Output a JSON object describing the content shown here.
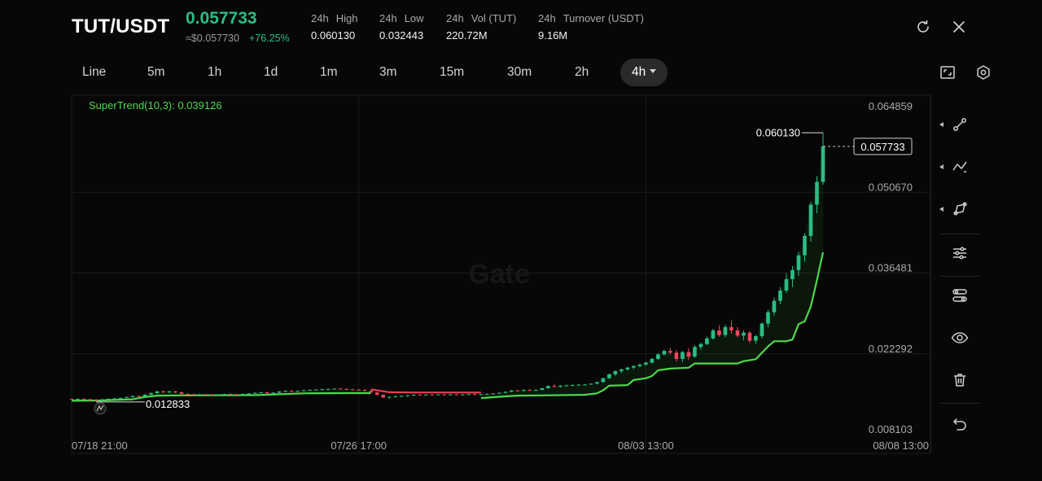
{
  "header": {
    "pair": "TUT/USDT",
    "price": "0.057733",
    "price_usd": "≈$0.057730",
    "change": "+76.25%",
    "stats": [
      {
        "label_a": "24h",
        "label_b": "High",
        "value": "0.060130"
      },
      {
        "label_a": "24h",
        "label_b": "Low",
        "value": "0.032443"
      },
      {
        "label_a": "24h",
        "label_b": "Vol (TUT)",
        "value": "220.72M"
      },
      {
        "label_a": "24h",
        "label_b": "Turnover (USDT)",
        "value": "9.16M"
      }
    ],
    "icons": [
      "refresh-icon",
      "close-icon"
    ]
  },
  "timeframes": {
    "items": [
      "Line",
      "5m",
      "1h",
      "1d",
      "1m",
      "3m",
      "15m",
      "30m",
      "2h",
      "4h"
    ],
    "active": "4h"
  },
  "toolbar_icons": [
    "fullscreen-icon",
    "settings-icon"
  ],
  "sidebar_tools": [
    "line-tool-icon",
    "path-tool-icon",
    "shape-tool-icon",
    "sliders-icon",
    "indicator-icon",
    "visibility-icon",
    "delete-icon",
    "undo-icon"
  ],
  "chart_data": {
    "type": "candlestick",
    "indicator_label": "SuperTrend(10,3): 0.039126",
    "indicator_value": 0.039126,
    "watermark": "Gate",
    "y_ticks": [
      "0.064859",
      "0.050670",
      "0.036481",
      "0.022292",
      "0.008103"
    ],
    "y_tick_values": [
      0.064859,
      0.05067,
      0.036481,
      0.022292,
      0.008103
    ],
    "ylim": [
      0.008103,
      0.064859
    ],
    "x_ticks": [
      "07/18 21:00",
      "07/26 17:00",
      "08/03 13:00",
      "08/08 13:00"
    ],
    "x_tick_values": [
      0,
      47,
      94,
      124
    ],
    "xlim": [
      0,
      124
    ],
    "current_price_label": "0.057733",
    "current_price": 0.057733,
    "high_label": "0.060130",
    "high_value": 0.06013,
    "low_label": "0.012833",
    "low_value": 0.012833,
    "colors": {
      "up": "#2bbd85",
      "down": "#f0455f",
      "trend_up": "#4cd94c",
      "trend_down": "#e8414f"
    },
    "candles": [
      [
        0,
        0.0134,
        0.01345,
        0.0133,
        0.01335
      ],
      [
        1,
        0.01335,
        0.01343,
        0.01326,
        0.01338
      ],
      [
        2,
        0.01338,
        0.01346,
        0.0133,
        0.01332
      ],
      [
        3,
        0.01332,
        0.0134,
        0.013,
        0.01318
      ],
      [
        4,
        0.01318,
        0.01335,
        0.0129,
        0.0131
      ],
      [
        5,
        0.0131,
        0.01338,
        0.013,
        0.0133
      ],
      [
        6,
        0.0133,
        0.01345,
        0.01325,
        0.0134
      ],
      [
        7,
        0.0134,
        0.01352,
        0.01335,
        0.01345
      ],
      [
        8,
        0.01345,
        0.0136,
        0.01338,
        0.01355
      ],
      [
        9,
        0.01355,
        0.01375,
        0.0135,
        0.0137
      ],
      [
        10,
        0.0137,
        0.01395,
        0.01362,
        0.01388
      ],
      [
        11,
        0.01388,
        0.014,
        0.01375,
        0.0138
      ],
      [
        12,
        0.0138,
        0.0142,
        0.01375,
        0.01412
      ],
      [
        13,
        0.01412,
        0.0145,
        0.01405,
        0.0144
      ],
      [
        14,
        0.0144,
        0.0148,
        0.0143,
        0.0147
      ],
      [
        15,
        0.0147,
        0.01485,
        0.01445,
        0.01455
      ],
      [
        16,
        0.01455,
        0.0148,
        0.0144,
        0.0147
      ],
      [
        17,
        0.0147,
        0.01478,
        0.0144,
        0.01452
      ],
      [
        18,
        0.01452,
        0.01465,
        0.01415,
        0.01425
      ],
      [
        19,
        0.01425,
        0.01438,
        0.01405,
        0.0142
      ],
      [
        20,
        0.0142,
        0.01432,
        0.014,
        0.0141
      ],
      [
        21,
        0.0141,
        0.01428,
        0.01402,
        0.01418
      ],
      [
        22,
        0.01418,
        0.01428,
        0.01405,
        0.01412
      ],
      [
        23,
        0.01412,
        0.01424,
        0.014,
        0.01408
      ],
      [
        24,
        0.01408,
        0.0142,
        0.01398,
        0.01415
      ],
      [
        25,
        0.01415,
        0.0143,
        0.01405,
        0.01422
      ],
      [
        26,
        0.01422,
        0.01432,
        0.0141,
        0.01418
      ],
      [
        27,
        0.01418,
        0.01428,
        0.01405,
        0.01412
      ],
      [
        28,
        0.01412,
        0.0143,
        0.014,
        0.01425
      ],
      [
        29,
        0.01425,
        0.0144,
        0.01415,
        0.01432
      ],
      [
        30,
        0.01432,
        0.01452,
        0.01425,
        0.01445
      ],
      [
        31,
        0.01445,
        0.01462,
        0.01438,
        0.01455
      ],
      [
        32,
        0.01455,
        0.01462,
        0.0143,
        0.0144
      ],
      [
        33,
        0.0144,
        0.01455,
        0.01432,
        0.01448
      ],
      [
        34,
        0.01448,
        0.01475,
        0.0144,
        0.01468
      ],
      [
        35,
        0.01468,
        0.0149,
        0.01458,
        0.0148
      ],
      [
        36,
        0.0148,
        0.01492,
        0.0146,
        0.0147
      ],
      [
        37,
        0.0147,
        0.01485,
        0.01462,
        0.01478
      ],
      [
        38,
        0.01478,
        0.01498,
        0.0147,
        0.0149
      ],
      [
        39,
        0.0149,
        0.01505,
        0.01482,
        0.01496
      ],
      [
        40,
        0.01496,
        0.0151,
        0.0149,
        0.01502
      ],
      [
        41,
        0.01502,
        0.01515,
        0.01492,
        0.01508
      ],
      [
        42,
        0.01508,
        0.0152,
        0.01498,
        0.01512
      ],
      [
        43,
        0.01512,
        0.01525,
        0.01504,
        0.01518
      ],
      [
        44,
        0.01518,
        0.01528,
        0.01505,
        0.01512
      ],
      [
        45,
        0.01512,
        0.01522,
        0.01498,
        0.01506
      ],
      [
        46,
        0.01506,
        0.01515,
        0.0149,
        0.015
      ],
      [
        47,
        0.015,
        0.01512,
        0.01488,
        0.01495
      ],
      [
        48,
        0.01495,
        0.01505,
        0.0147,
        0.0148
      ],
      [
        49,
        0.0148,
        0.0149,
        0.0144,
        0.0145
      ],
      [
        50,
        0.0145,
        0.01462,
        0.014,
        0.0141
      ],
      [
        51,
        0.0141,
        0.01422,
        0.0135,
        0.01362
      ],
      [
        52,
        0.01362,
        0.0138,
        0.01338,
        0.01375
      ],
      [
        53,
        0.01375,
        0.01392,
        0.0136,
        0.01385
      ],
      [
        54,
        0.01385,
        0.01398,
        0.0137,
        0.0139
      ],
      [
        55,
        0.0139,
        0.01408,
        0.01375,
        0.014
      ],
      [
        56,
        0.014,
        0.01418,
        0.01388,
        0.0141
      ],
      [
        57,
        0.0141,
        0.0142,
        0.01395,
        0.01405
      ],
      [
        58,
        0.01405,
        0.01418,
        0.01396,
        0.01412
      ],
      [
        59,
        0.01412,
        0.01422,
        0.014,
        0.01408
      ],
      [
        60,
        0.01408,
        0.0142,
        0.01398,
        0.01415
      ],
      [
        61,
        0.01415,
        0.01426,
        0.01402,
        0.0141
      ],
      [
        62,
        0.0141,
        0.01422,
        0.014,
        0.01416
      ],
      [
        63,
        0.01416,
        0.01426,
        0.01404,
        0.0141
      ],
      [
        64,
        0.0141,
        0.01422,
        0.01398,
        0.01414
      ],
      [
        65,
        0.01414,
        0.01428,
        0.01406,
        0.0142
      ],
      [
        66,
        0.0142,
        0.01432,
        0.01408,
        0.01412
      ],
      [
        67,
        0.01412,
        0.01425,
        0.01402,
        0.01418
      ],
      [
        68,
        0.01418,
        0.0143,
        0.0141,
        0.01425
      ],
      [
        69,
        0.01425,
        0.0144,
        0.0142,
        0.01435
      ],
      [
        70,
        0.01435,
        0.01452,
        0.01428,
        0.01445
      ],
      [
        71,
        0.01445,
        0.0147,
        0.01438,
        0.01462
      ],
      [
        72,
        0.01462,
        0.01492,
        0.01455,
        0.01485
      ],
      [
        73,
        0.01485,
        0.01498,
        0.0147,
        0.01478
      ],
      [
        74,
        0.01478,
        0.015,
        0.0147,
        0.01495
      ],
      [
        75,
        0.01495,
        0.01508,
        0.0148,
        0.01488
      ],
      [
        76,
        0.01488,
        0.01502,
        0.01478,
        0.01495
      ],
      [
        77,
        0.01495,
        0.0153,
        0.0149,
        0.01525
      ],
      [
        78,
        0.01525,
        0.01575,
        0.01515,
        0.01565
      ],
      [
        79,
        0.01565,
        0.01605,
        0.0154,
        0.01555
      ],
      [
        80,
        0.01555,
        0.0158,
        0.01535,
        0.0157
      ],
      [
        81,
        0.0157,
        0.0159,
        0.01555,
        0.01575
      ],
      [
        82,
        0.01575,
        0.0159,
        0.01558,
        0.01582
      ],
      [
        83,
        0.01582,
        0.01598,
        0.0157,
        0.01588
      ],
      [
        84,
        0.01588,
        0.01602,
        0.01575,
        0.01592
      ],
      [
        85,
        0.01592,
        0.01612,
        0.01585,
        0.01605
      ],
      [
        86,
        0.01605,
        0.0164,
        0.01598,
        0.01632
      ],
      [
        87,
        0.01632,
        0.0171,
        0.01625,
        0.017
      ],
      [
        88,
        0.017,
        0.0178,
        0.0169,
        0.0177
      ],
      [
        89,
        0.0177,
        0.0184,
        0.0174,
        0.01825
      ],
      [
        90,
        0.01825,
        0.0187,
        0.0179,
        0.01855
      ],
      [
        91,
        0.01855,
        0.019,
        0.0183,
        0.01888
      ],
      [
        92,
        0.01888,
        0.0193,
        0.0186,
        0.01915
      ],
      [
        93,
        0.01915,
        0.0196,
        0.0189,
        0.0194
      ],
      [
        94,
        0.0194,
        0.0199,
        0.0192,
        0.01975
      ],
      [
        95,
        0.01975,
        0.0206,
        0.0196,
        0.0204
      ],
      [
        96,
        0.0204,
        0.0214,
        0.0202,
        0.0212
      ],
      [
        97,
        0.0212,
        0.022,
        0.021,
        0.0218
      ],
      [
        98,
        0.0218,
        0.0223,
        0.0212,
        0.0215
      ],
      [
        99,
        0.0215,
        0.022,
        0.0199,
        0.0204
      ],
      [
        100,
        0.0204,
        0.0218,
        0.0198,
        0.0216
      ],
      [
        101,
        0.0216,
        0.0223,
        0.0202,
        0.0208
      ],
      [
        102,
        0.0208,
        0.0228,
        0.0206,
        0.0225
      ],
      [
        103,
        0.0225,
        0.0233,
        0.022,
        0.023
      ],
      [
        104,
        0.023,
        0.0243,
        0.0228,
        0.024
      ],
      [
        105,
        0.024,
        0.0257,
        0.0238,
        0.0254
      ],
      [
        106,
        0.0254,
        0.0263,
        0.0243,
        0.0246
      ],
      [
        107,
        0.0246,
        0.0264,
        0.0242,
        0.026
      ],
      [
        108,
        0.026,
        0.0272,
        0.0248,
        0.0254
      ],
      [
        109,
        0.0254,
        0.026,
        0.0242,
        0.0245
      ],
      [
        110,
        0.0245,
        0.0254,
        0.0237,
        0.025
      ],
      [
        111,
        0.025,
        0.0253,
        0.0232,
        0.0236
      ],
      [
        112,
        0.0236,
        0.0246,
        0.023,
        0.0244
      ],
      [
        113,
        0.0244,
        0.0268,
        0.024,
        0.0266
      ],
      [
        114,
        0.0266,
        0.029,
        0.026,
        0.0286
      ],
      [
        115,
        0.0286,
        0.0312,
        0.028,
        0.0306
      ],
      [
        116,
        0.0306,
        0.033,
        0.03,
        0.0324
      ],
      [
        117,
        0.0324,
        0.0355,
        0.032,
        0.0344
      ],
      [
        118,
        0.0344,
        0.0367,
        0.033,
        0.036
      ],
      [
        119,
        0.036,
        0.0392,
        0.035,
        0.0386
      ],
      [
        120,
        0.0386,
        0.0425,
        0.0375,
        0.042
      ],
      [
        121,
        0.042,
        0.048,
        0.041,
        0.0475
      ],
      [
        122,
        0.0475,
        0.0525,
        0.046,
        0.0515
      ],
      [
        123,
        0.0515,
        0.06013,
        0.051,
        0.05773
      ]
    ],
    "supertrend": [
      [
        0,
        0.01305,
        "up"
      ],
      [
        5,
        0.0131,
        "up"
      ],
      [
        10,
        0.0133,
        "up"
      ],
      [
        12,
        0.0137,
        "up"
      ],
      [
        14,
        0.01395,
        "up"
      ],
      [
        18,
        0.014,
        "up"
      ],
      [
        30,
        0.01403,
        "up"
      ],
      [
        38,
        0.01435,
        "up"
      ],
      [
        46,
        0.0144,
        "up"
      ],
      [
        49,
        0.0144,
        "up"
      ],
      [
        49,
        0.01505,
        "down"
      ],
      [
        52,
        0.01455,
        "down"
      ],
      [
        56,
        0.0145,
        "down"
      ],
      [
        66,
        0.0145,
        "down"
      ],
      [
        67,
        0.01448,
        "down"
      ],
      [
        67,
        0.0135,
        "up"
      ],
      [
        70,
        0.01375,
        "up"
      ],
      [
        73,
        0.01395,
        "up"
      ],
      [
        77,
        0.014,
        "up"
      ],
      [
        84,
        0.0141,
        "up"
      ],
      [
        86,
        0.01435,
        "up"
      ],
      [
        87,
        0.0149,
        "up"
      ],
      [
        88,
        0.0157,
        "up"
      ],
      [
        91,
        0.0158,
        "up"
      ],
      [
        92,
        0.0167,
        "up"
      ],
      [
        94,
        0.017,
        "up"
      ],
      [
        95,
        0.0174,
        "up"
      ],
      [
        96,
        0.0184,
        "up"
      ],
      [
        98,
        0.0187,
        "up"
      ],
      [
        101,
        0.01885,
        "up"
      ],
      [
        102,
        0.0196,
        "up"
      ],
      [
        109,
        0.0196,
        "up"
      ],
      [
        110,
        0.02,
        "up"
      ],
      [
        112,
        0.02035,
        "up"
      ],
      [
        114,
        0.0226,
        "up"
      ],
      [
        115,
        0.0235,
        "up"
      ],
      [
        117,
        0.0235,
        "up"
      ],
      [
        118,
        0.0238,
        "up"
      ],
      [
        119,
        0.0265,
        "up"
      ],
      [
        120,
        0.027,
        "up"
      ],
      [
        121,
        0.0296,
        "up"
      ],
      [
        122,
        0.0342,
        "up"
      ],
      [
        123,
        0.03913,
        "up"
      ]
    ]
  }
}
